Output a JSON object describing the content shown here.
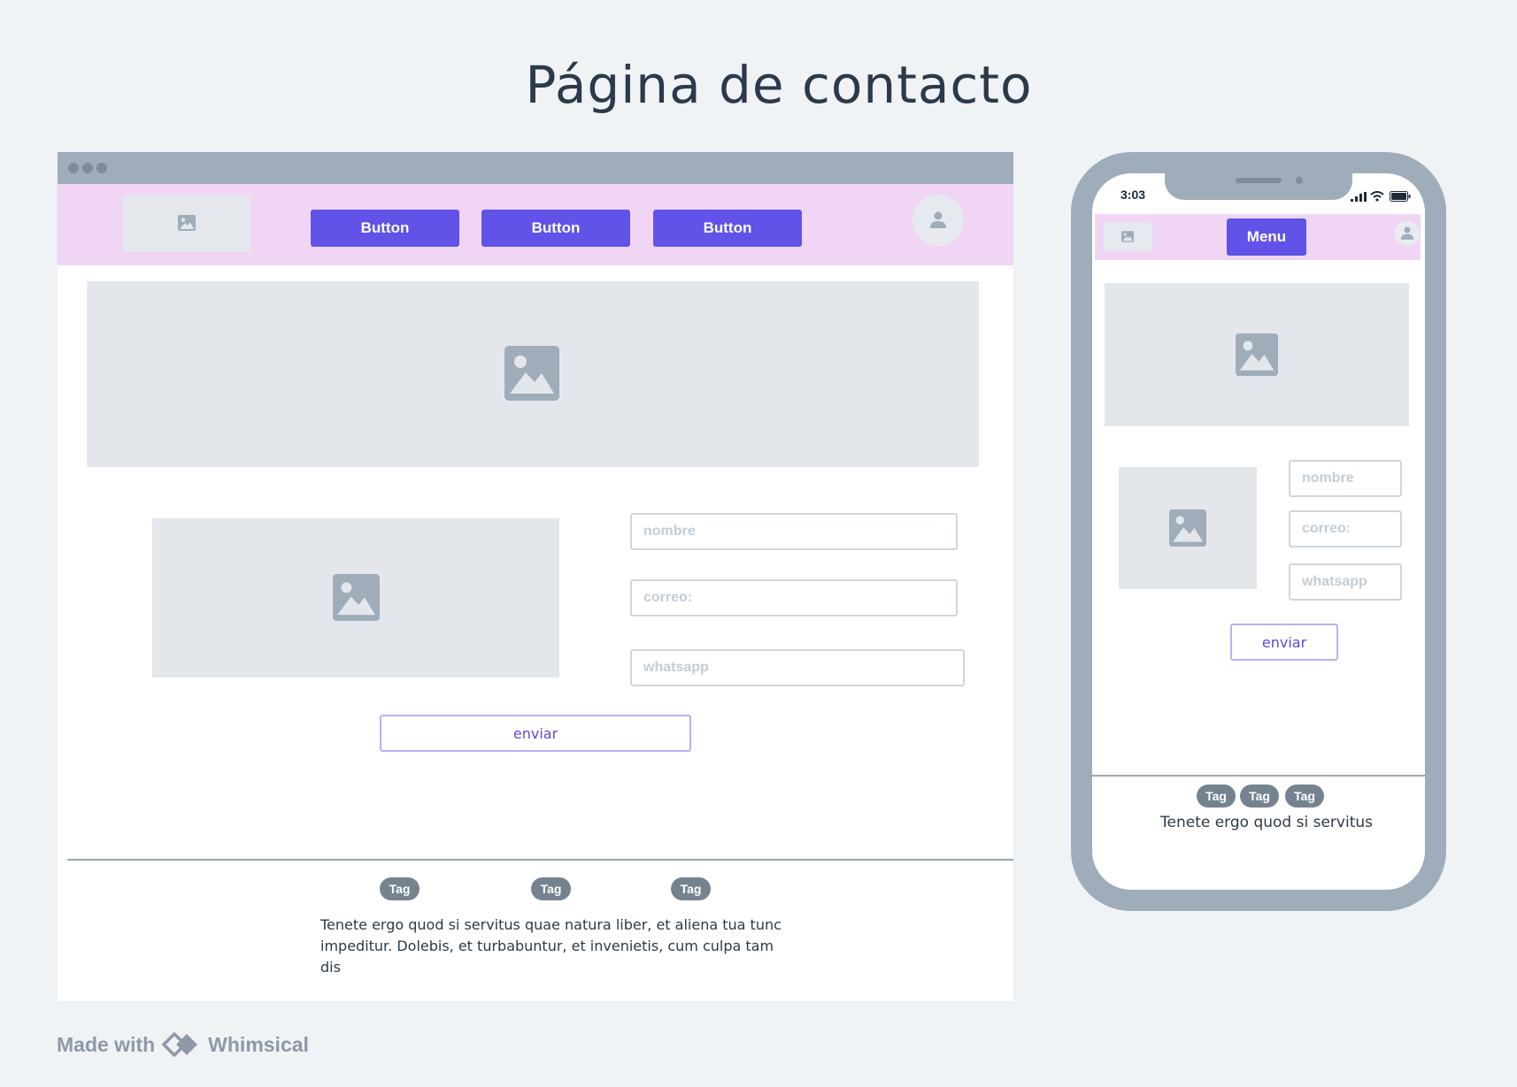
{
  "page_title": "Página de contacto",
  "colors": {
    "accent": "#6153e7",
    "nav_background": "#f0d6f4",
    "frame": "#9eadb9",
    "placeholder": "#e3e7eb",
    "tag": "#758391"
  },
  "desktop": {
    "nav": {
      "logo_icon": "image-icon",
      "buttons": [
        "Button",
        "Button",
        "Button"
      ],
      "avatar_icon": "user-icon"
    },
    "hero_icon": "image-icon",
    "side_image_icon": "image-icon",
    "form": {
      "nombre_placeholder": "nombre",
      "correo_placeholder": "correo:",
      "whatsapp_placeholder": "whatsapp",
      "submit_label": "enviar"
    },
    "footer": {
      "tags": [
        "Tag",
        "Tag",
        "Tag"
      ],
      "text": "Tenete ergo quod si servitus quae natura liber, et aliena tua tunc impeditur. Dolebis, et turbabuntur, et invenietis, cum culpa tam dis"
    }
  },
  "mobile": {
    "status": {
      "time": "3:03",
      "icons": [
        "signal-icon",
        "wifi-icon",
        "battery-icon"
      ]
    },
    "nav": {
      "logo_icon": "image-icon",
      "menu_label": "Menu",
      "avatar_icon": "user-icon"
    },
    "form": {
      "nombre_placeholder": "nombre",
      "correo_placeholder": "correo:",
      "whatsapp_placeholder": "whatsapp",
      "submit_label": "enviar"
    },
    "footer": {
      "tags": [
        "Tag",
        "Tag",
        "Tag"
      ],
      "text": "Tenete ergo quod si servitus"
    }
  },
  "branding": {
    "made_with": "Made with",
    "brand": "Whimsical",
    "brand_icon": "whimsical-logo-icon"
  }
}
